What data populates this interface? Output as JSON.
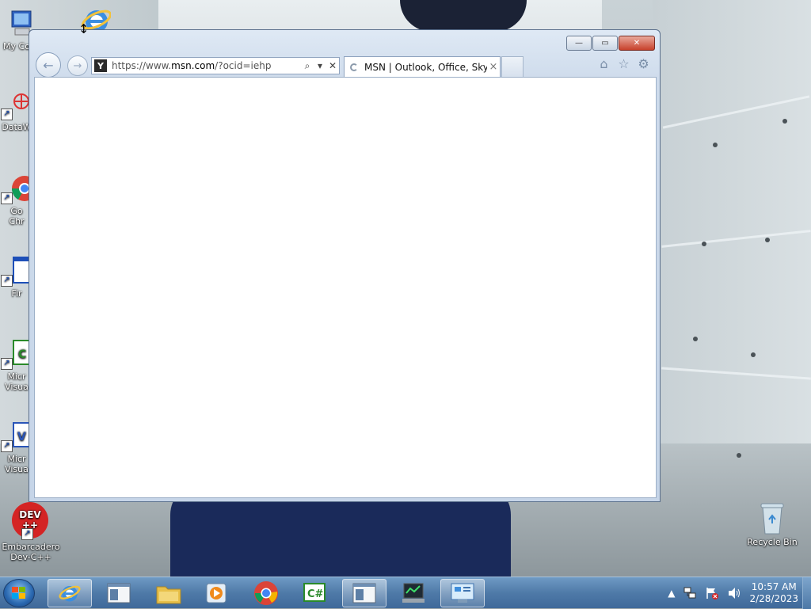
{
  "desktop": {
    "icons": [
      {
        "label": "My Co",
        "icon": "computer-icon"
      },
      {
        "label": "DataW",
        "icon": "datawarehouse-icon"
      },
      {
        "label": "Go\nChr",
        "icon": "chrome-icon"
      },
      {
        "label": "Fir",
        "icon": "file-icon"
      },
      {
        "label": "Micr\nVisua",
        "icon": "visual-studio-icon"
      },
      {
        "label": "Micr\nVisua",
        "icon": "visual-studio-icon"
      },
      {
        "label": "Embarcadero\nDev-C++",
        "icon": "devcpp-icon"
      },
      {
        "label": "Recycle Bin",
        "icon": "recycle-bin-icon"
      }
    ],
    "devcpp_badge": "DEV\n++"
  },
  "browser": {
    "address": {
      "url_prefix": "https://www.",
      "url_domain": "msn.com",
      "url_suffix": "/?ocid=iehp",
      "favicon_letter": "Y"
    },
    "tab": {
      "title": "MSN | Outlook, Office, Sky...",
      "close": "×"
    },
    "controls": {
      "minimize": "—",
      "maximize": "▭",
      "close": "✕"
    },
    "toolbar": {
      "home": "⌂",
      "favorites": "☆",
      "settings": "⚙"
    },
    "nav": {
      "back": "←",
      "forward": "→"
    },
    "addr_tools": {
      "search": "⌕",
      "dropdown": "▾",
      "stop": "✕"
    }
  },
  "taskbar": {
    "items": [
      {
        "icon": "internet-explorer-icon",
        "active": true
      },
      {
        "icon": "window-app-icon",
        "active": false
      },
      {
        "icon": "file-explorer-icon",
        "active": false
      },
      {
        "icon": "media-player-icon",
        "active": false
      },
      {
        "icon": "chrome-icon",
        "active": false
      },
      {
        "icon": "csharp-icon",
        "active": false
      },
      {
        "icon": "window-app-icon",
        "active": true
      },
      {
        "icon": "monitor-app-icon",
        "active": false
      },
      {
        "icon": "control-panel-icon",
        "active": true
      }
    ],
    "clock": {
      "time": "10:57 AM",
      "date": "2/28/2023"
    },
    "tray_arrow": "▲"
  },
  "colors": {
    "taskbar": "#4f7aa8",
    "window_frame": "#cfdcec",
    "close_red": "#c7412b"
  }
}
